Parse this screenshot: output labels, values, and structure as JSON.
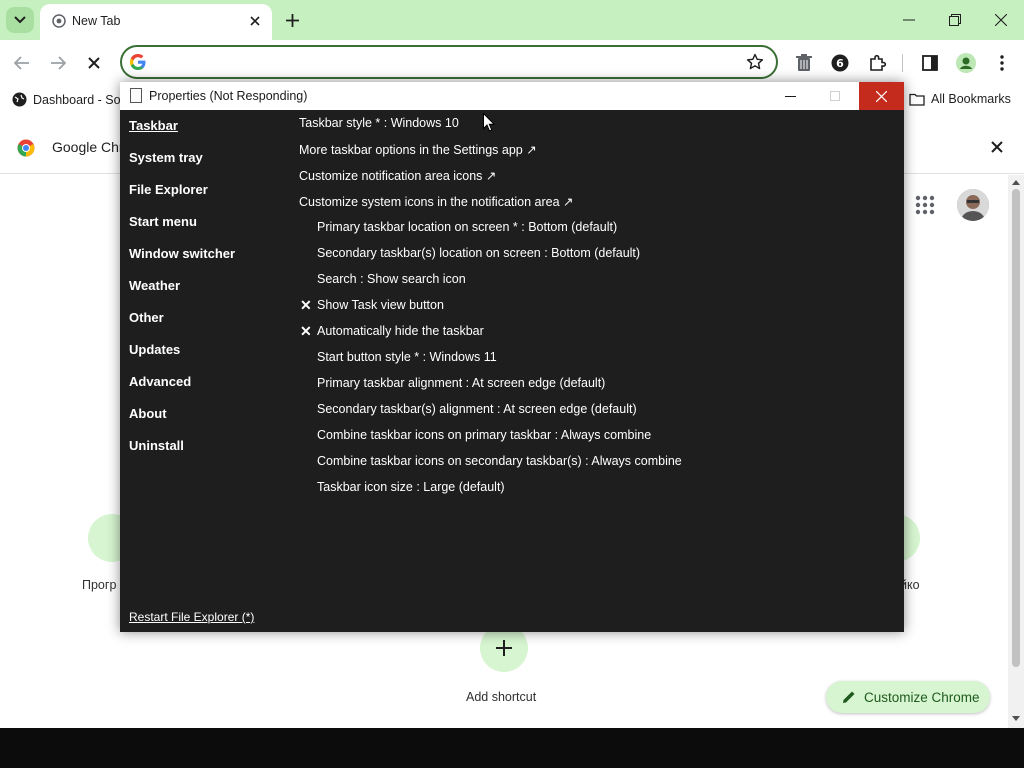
{
  "browser": {
    "tab_title": "New Tab",
    "omnibox_value": "",
    "bookmarks": {
      "item1_label": "Dashboard - Soc",
      "all_bookmarks_label": "All Bookmarks"
    },
    "infobar_text": "Google Chro",
    "ntp": {
      "shortcut_left_label": "Прогр",
      "shortcut_right_label": "йко",
      "add_shortcut_label": "Add shortcut",
      "customize_label": "Customize Chrome"
    }
  },
  "dialog": {
    "title": "Properties (Not Responding)",
    "menu": [
      {
        "label": "Taskbar",
        "active": true
      },
      {
        "label": "System tray"
      },
      {
        "label": "File Explorer"
      },
      {
        "label": "Start menu"
      },
      {
        "label": "Window switcher"
      },
      {
        "label": "Weather"
      },
      {
        "label": "Other"
      },
      {
        "label": "Updates"
      },
      {
        "label": "Advanced"
      },
      {
        "label": "About"
      },
      {
        "label": "Uninstall"
      }
    ],
    "restart_label": "Restart File Explorer (*)",
    "options": [
      {
        "label": "Taskbar style * : Windows 10"
      },
      {
        "label": "More taskbar options in the Settings app ↗"
      },
      {
        "label": "Customize notification area icons ↗"
      },
      {
        "label": "Customize system icons in the notification area ↗"
      },
      {
        "label": "Primary taskbar location on screen * : Bottom (default)"
      },
      {
        "label": "Secondary taskbar(s) location on screen : Bottom (default)"
      },
      {
        "label": "Search : Show search icon"
      },
      {
        "label": "Show Task view button",
        "checked": true
      },
      {
        "label": "Automatically hide the taskbar",
        "checked": true
      },
      {
        "label": "Start button style * : Windows 11"
      },
      {
        "label": "Primary taskbar alignment : At screen edge (default)"
      },
      {
        "label": "Secondary taskbar(s) alignment : At screen edge (default)"
      },
      {
        "label": "Combine taskbar icons on primary taskbar : Always combine"
      },
      {
        "label": "Combine taskbar icons on secondary taskbar(s) : Always combine"
      },
      {
        "label": "Taskbar icon size : Large (default)"
      }
    ],
    "check_mark": "✕"
  },
  "colors": {
    "tabstrip": "#c7f0c1",
    "dialog_bg": "#1e1e1e",
    "close_red": "#c42b1c",
    "accent_green": "#d6f5d0"
  }
}
